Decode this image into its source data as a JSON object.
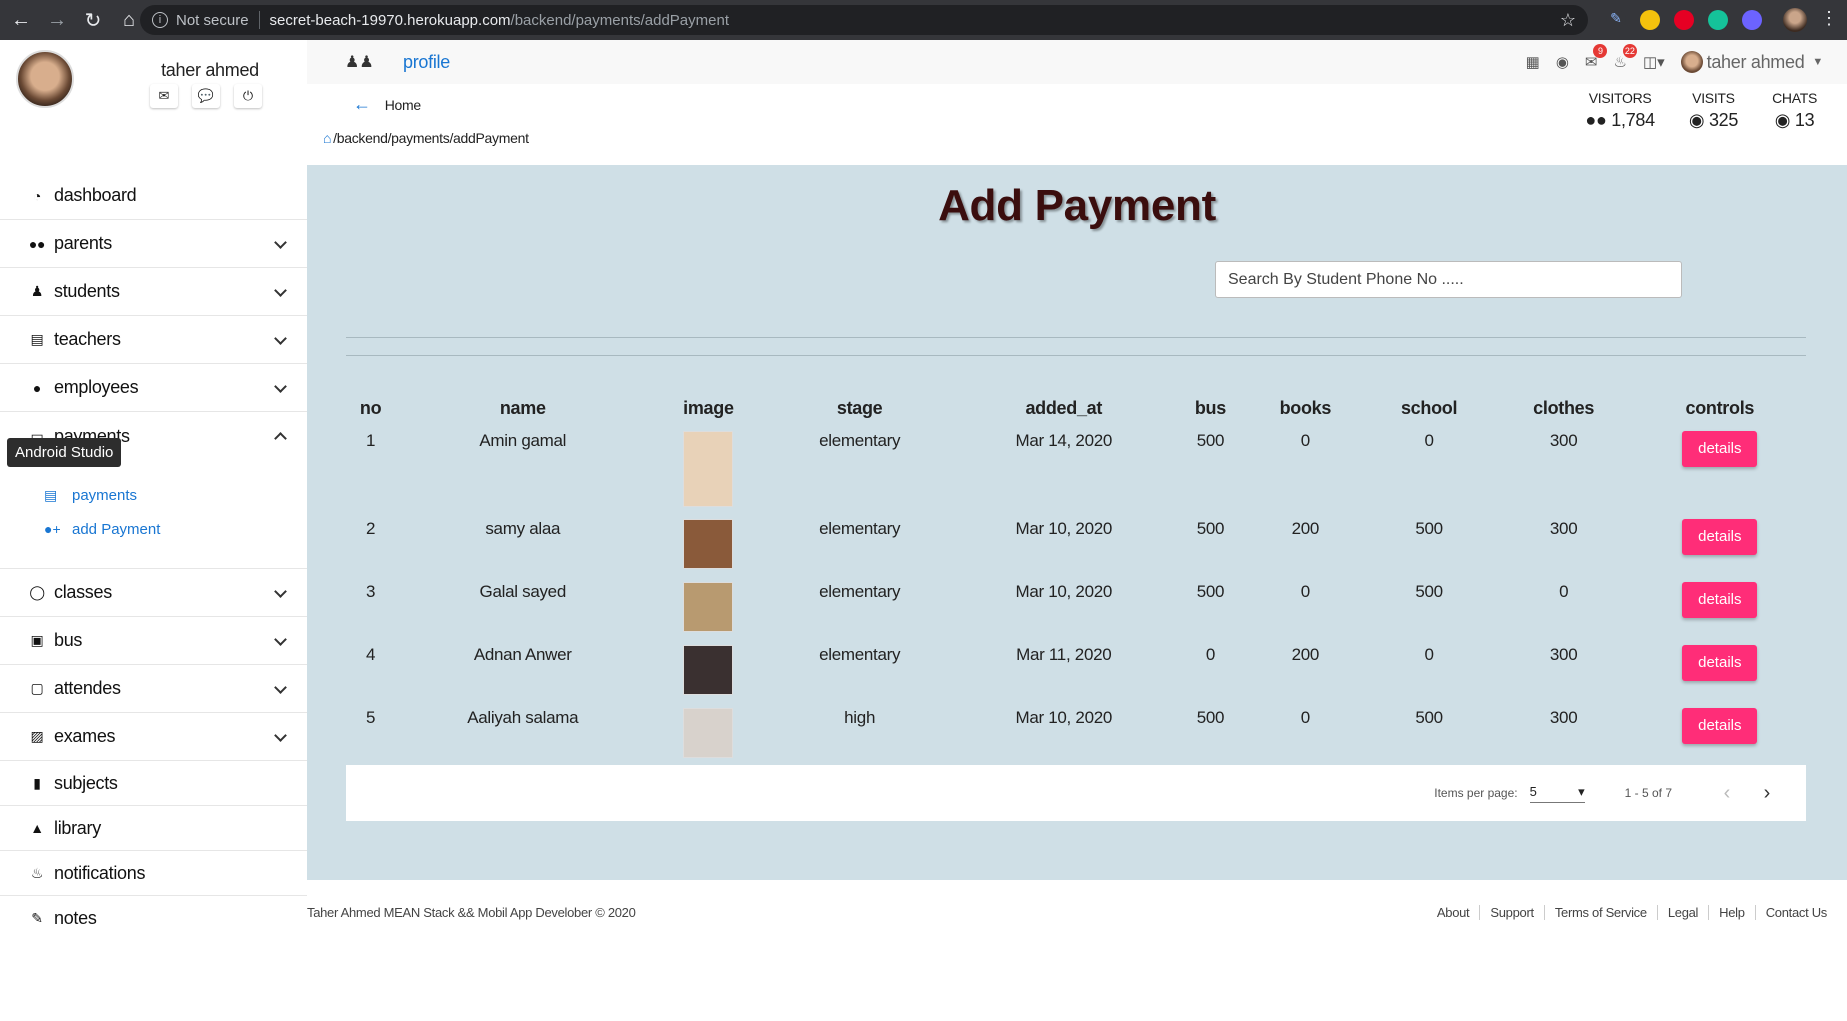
{
  "browser": {
    "security": "Not secure",
    "url_host": "secret-beach-19970.herokuapp.com",
    "url_path": "/backend/payments/addPayment"
  },
  "sidebar": {
    "user_name": "taher ahmed",
    "items": [
      {
        "label": "dashboard",
        "icon": "dashboard-icon",
        "chevron": false
      },
      {
        "label": "parents",
        "icon": "users-icon",
        "chevron": true
      },
      {
        "label": "students",
        "icon": "child-icon",
        "chevron": true
      },
      {
        "label": "teachers",
        "icon": "chalkboard-icon",
        "chevron": true
      },
      {
        "label": "employees",
        "icon": "user-icon",
        "chevron": true
      },
      {
        "label": "payments",
        "icon": "wallet-icon",
        "chevron": true,
        "expanded": true
      },
      {
        "label": "classes",
        "icon": "lightbulb-icon",
        "chevron": true
      },
      {
        "label": "bus",
        "icon": "bus-icon",
        "chevron": true
      },
      {
        "label": "attendes",
        "icon": "clipboard-icon",
        "chevron": true
      },
      {
        "label": "exames",
        "icon": "file-export-icon",
        "chevron": true
      },
      {
        "label": "subjects",
        "icon": "book-icon",
        "chevron": false
      },
      {
        "label": "library",
        "icon": "shapes-icon",
        "chevron": false
      },
      {
        "label": "notifications",
        "icon": "bell-icon",
        "chevron": false
      },
      {
        "label": "notes",
        "icon": "pen-icon",
        "chevron": false
      }
    ],
    "payments_sub": [
      {
        "label": "payments",
        "icon": "chalkboard-icon"
      },
      {
        "label": "add Payment",
        "icon": "user-plus-icon"
      }
    ]
  },
  "tooltip": "Android Studio",
  "topbar": {
    "profile_link": "profile",
    "mail_badge": "9",
    "bell_badge": "22",
    "user_name": "taher ahmed"
  },
  "subhead": {
    "home": "Home",
    "breadcrumb": "/backend/payments/addPayment",
    "stats": [
      {
        "label": "VISITORS",
        "value": "1,784",
        "icon": "users-icon"
      },
      {
        "label": "VISITS",
        "value": "325",
        "icon": "globe-icon"
      },
      {
        "label": "CHATS",
        "value": "13",
        "icon": "comments-icon"
      }
    ]
  },
  "main": {
    "title": "Add Payment",
    "search_placeholder": "Search By Student Phone No .....",
    "columns": [
      "no",
      "name",
      "image",
      "stage",
      "added_at",
      "bus",
      "books",
      "school",
      "clothes",
      "controls"
    ],
    "rows": [
      {
        "no": "1",
        "name": "Amin gamal",
        "stage": "elementary",
        "added_at": "Mar 14, 2020",
        "bus": "500",
        "books": "0",
        "school": "0",
        "clothes": "300",
        "action": "details",
        "photo_bg": "#e8d2b8"
      },
      {
        "no": "2",
        "name": "samy alaa",
        "stage": "elementary",
        "added_at": "Mar 10, 2020",
        "bus": "500",
        "books": "200",
        "school": "500",
        "clothes": "300",
        "action": "details",
        "photo_bg": "#8a5a3a"
      },
      {
        "no": "3",
        "name": "Galal sayed",
        "stage": "elementary",
        "added_at": "Mar 10, 2020",
        "bus": "500",
        "books": "0",
        "school": "500",
        "clothes": "0",
        "action": "details",
        "photo_bg": "#b89a70"
      },
      {
        "no": "4",
        "name": "Adnan Anwer",
        "stage": "elementary",
        "added_at": "Mar 11, 2020",
        "bus": "0",
        "books": "200",
        "school": "0",
        "clothes": "300",
        "action": "details",
        "photo_bg": "#3a3030"
      },
      {
        "no": "5",
        "name": "Aaliyah salama",
        "stage": "high",
        "added_at": "Mar 10, 2020",
        "bus": "500",
        "books": "0",
        "school": "500",
        "clothes": "300",
        "action": "details",
        "photo_bg": "#d8d2cc"
      }
    ],
    "paginator": {
      "items_per_page_label": "Items per page:",
      "items_per_page": "5",
      "range": "1 - 5 of 7"
    }
  },
  "footer": {
    "copyright": "Taher Ahmed MEAN Stack && Mobil App Develober © 2020",
    "links": [
      "About",
      "Support",
      "Terms of Service",
      "Legal",
      "Help",
      "Contact Us"
    ]
  },
  "colors": {
    "accent": "#1976d2",
    "main_bg": "#cfdfe6",
    "button": "#ff2d78",
    "title": "#3b0e0e"
  }
}
